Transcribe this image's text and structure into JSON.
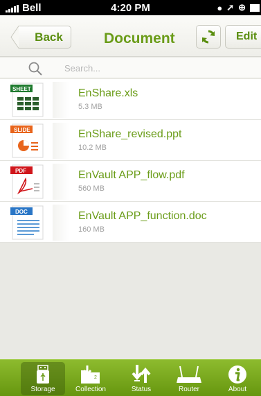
{
  "status_bar": {
    "carrier": "Bell",
    "time": "4:20 PM"
  },
  "nav": {
    "back_label": "Back",
    "title": "Document",
    "edit_label": "Edit"
  },
  "search": {
    "placeholder": "Search..."
  },
  "files": [
    {
      "name": "EnShare.xls",
      "size": "5.3 MB",
      "type_badge": "SHEET",
      "badge_color": "#1e7a2e",
      "icon": "spreadsheet-icon"
    },
    {
      "name": "EnShare_revised.ppt",
      "size": "10.2 MB",
      "type_badge": "SLIDE",
      "badge_color": "#e8641b",
      "icon": "slide-icon"
    },
    {
      "name": "EnVault APP_flow.pdf",
      "size": "560 MB",
      "type_badge": "PDF",
      "badge_color": "#d0161b",
      "icon": "pdf-icon"
    },
    {
      "name": "EnVault APP_function.doc",
      "size": "160 MB",
      "type_badge": "DOC",
      "badge_color": "#2a76c6",
      "icon": "doc-icon"
    }
  ],
  "tabs": [
    {
      "label": "Storage",
      "icon": "usb-storage-icon",
      "active": true
    },
    {
      "label": "Collection",
      "icon": "collection-folder-icon",
      "active": false
    },
    {
      "label": "Status",
      "icon": "transfer-status-icon",
      "active": false
    },
    {
      "label": "Router",
      "icon": "router-icon",
      "active": false
    },
    {
      "label": "About",
      "icon": "info-icon",
      "active": false
    }
  ],
  "colors": {
    "accent_green": "#6a9c18",
    "tab_bar_green": "#7aab20"
  }
}
